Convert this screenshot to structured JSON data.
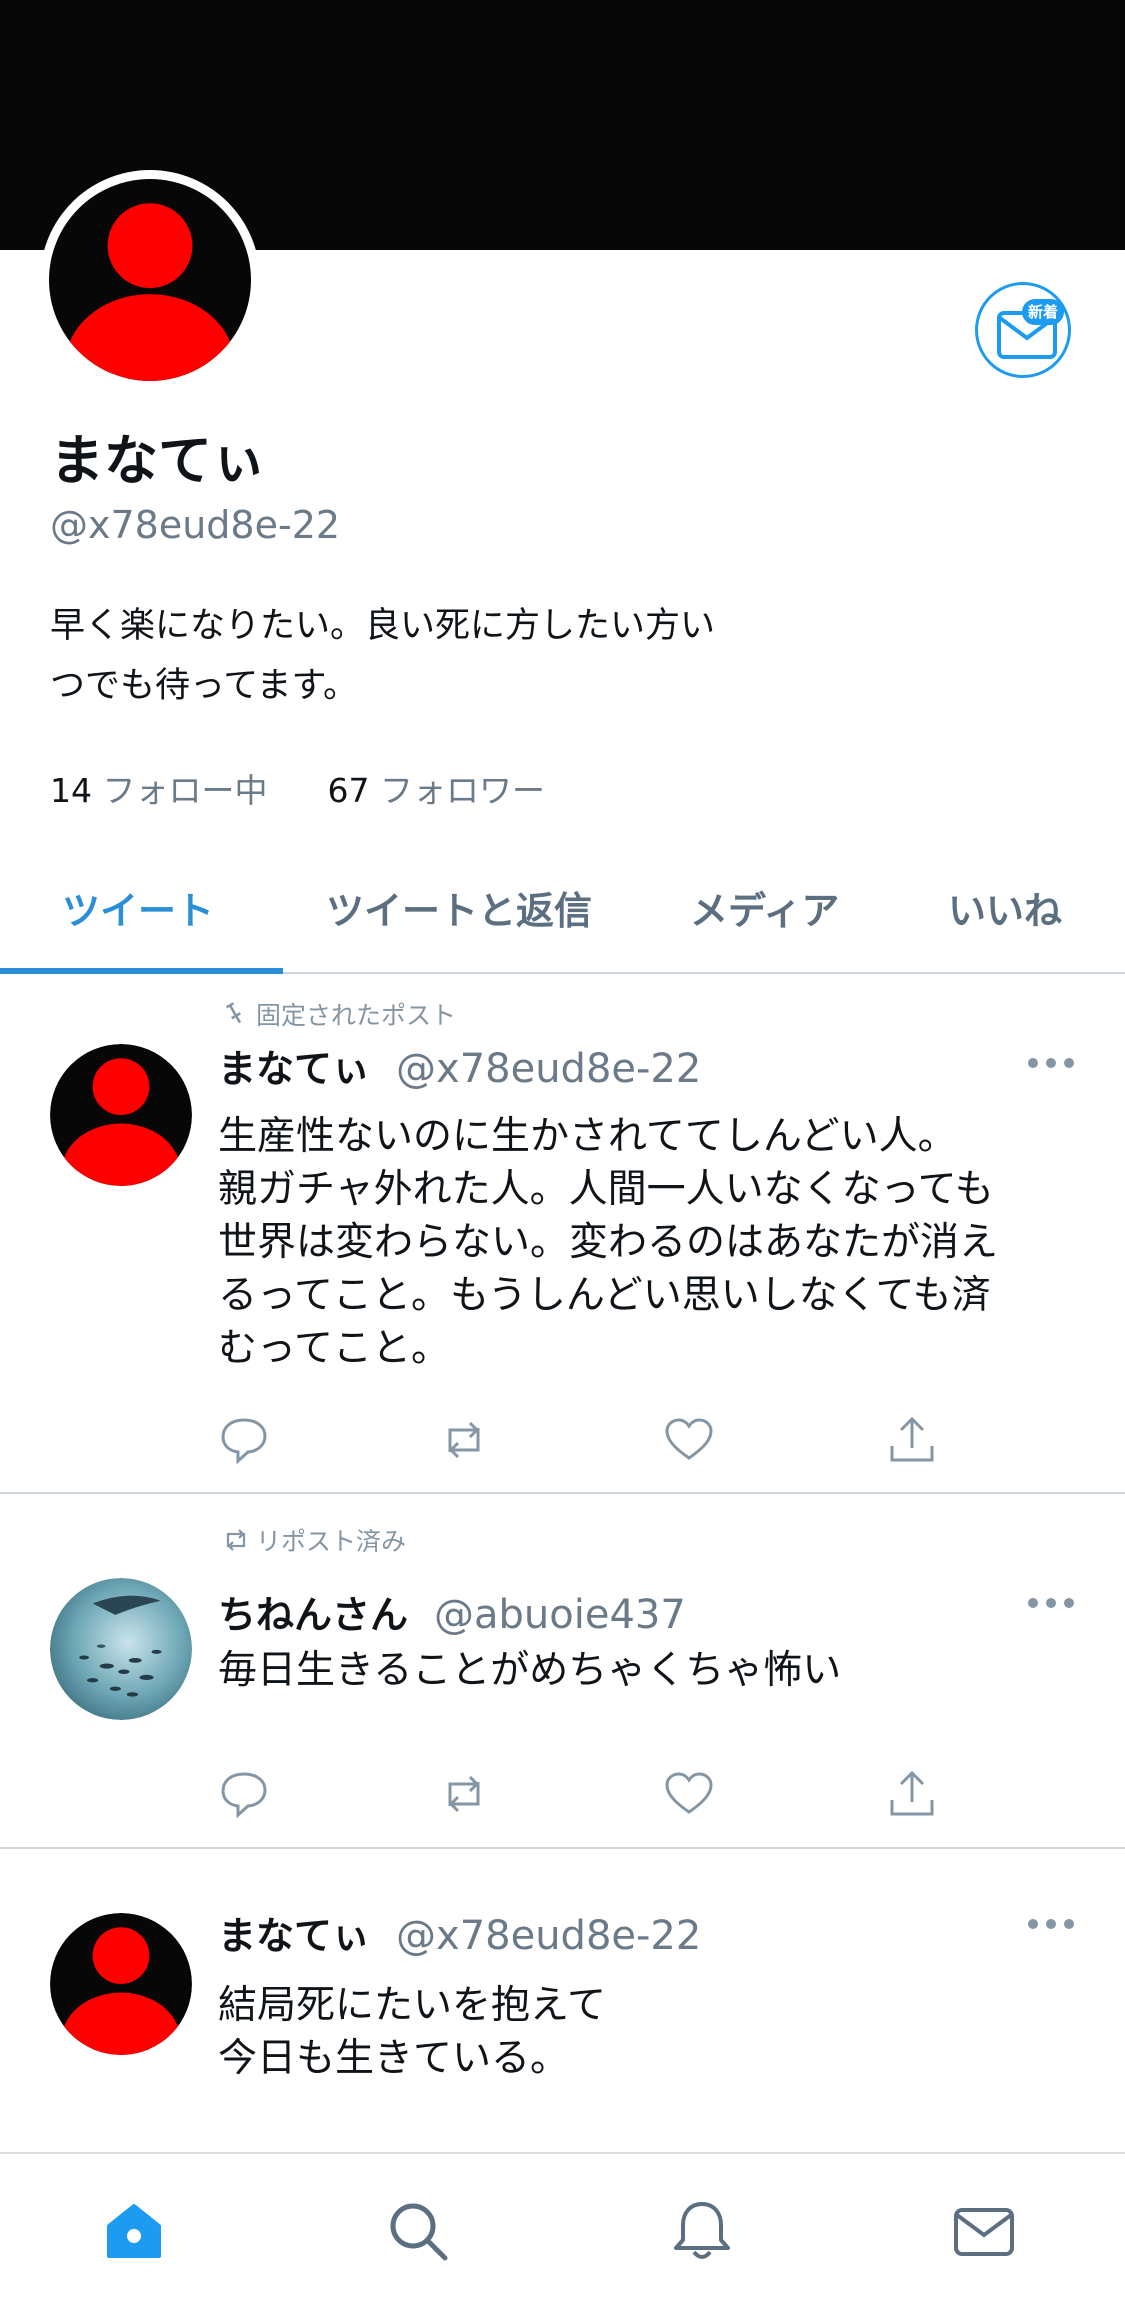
{
  "profile": {
    "display_name": "まなてぃ",
    "handle": "@x78eud8e-22",
    "bio_line1": "早く楽になりたい。良い死に方したい方い",
    "bio_line2": "つでも待ってます。",
    "following_count": "14",
    "following_label": "フォロー中",
    "followers_count": "67",
    "followers_label": "フォロワー",
    "dm_badge": "新着"
  },
  "tabs": [
    {
      "label": "ツイート",
      "active": true
    },
    {
      "label": "ツイートと返信",
      "active": false
    },
    {
      "label": "メディア",
      "active": false
    },
    {
      "label": "いいね",
      "active": false
    }
  ],
  "tweets": [
    {
      "context": "固定されたポスト",
      "name": "まなてぃ",
      "handle": "@x78eud8e-22",
      "lines": [
        "生産性ないのに生かされててしんどい人。",
        "親ガチャ外れた人。人間一人いなくなっても",
        "世界は変わらない。変わるのはあなたが消え",
        "るってこと。もうしんどい思いしなくても済",
        "むってこと。"
      ]
    },
    {
      "context": "リポスト済み",
      "name": "ちねんさん",
      "handle": "@abuoie437",
      "lines": [
        "毎日生きることがめちゃくちゃ怖い"
      ]
    },
    {
      "context": "",
      "name": "まなてぃ",
      "handle": "@x78eud8e-22",
      "lines": [
        "結局死にたいを抱えて",
        "今日も生きている。"
      ]
    }
  ],
  "colors": {
    "accent": "#1d9bf0",
    "avatar_red": "#ff0000",
    "banner": "#070707"
  },
  "icons": {
    "reply": "reply-icon",
    "retweet": "retweet-icon",
    "like": "heart-icon",
    "share": "share-icon",
    "home": "home-icon",
    "search": "search-icon",
    "notifications": "bell-icon",
    "messages": "envelope-icon"
  }
}
